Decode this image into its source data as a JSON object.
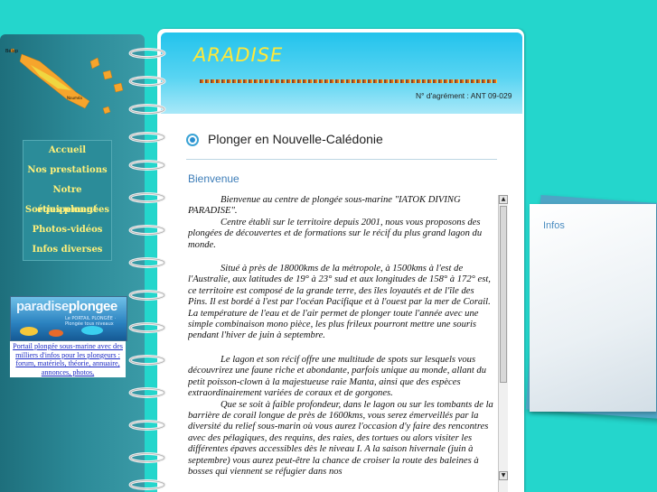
{
  "header": {
    "logo_text": "ARADISE",
    "agrement": "N° d'agrément : ANT 09-029"
  },
  "nav": {
    "items": [
      {
        "label": "Accueil"
      },
      {
        "label": "Nos prestations"
      },
      {
        "label": "Notre équipement"
      },
      {
        "label": "Sorties plongées"
      },
      {
        "label": "Photos-vidéos"
      },
      {
        "label": "Infos diverses"
      }
    ]
  },
  "banner": {
    "title_part1": "paradise",
    "title_part2": "plongee",
    "subtitle": "Le PORTAIL PLONGÉE · Plongée tous niveaux"
  },
  "portal_link": {
    "text": "Portail plongée sous-marine avec des milliers d'infos pour les plongeurs : forum, matériels, théorie, annuaire, annonces, photos,"
  },
  "main": {
    "title": "Plonger en Nouvelle-Calédonie",
    "section": "Bienvenue",
    "paragraphs": [
      "Bienvenue au centre de plongée sous-marine \"IATOK DIVING PARADISE\".",
      "Centre établi sur le territoire depuis 2001, nous vous proposons des plongées de découvertes et de formations sur le récif du plus grand lagon du monde.",
      "Situé à près de 18000kms de la métropole, à 1500kms à l'est de l'Australie, aux latitudes de 19° à 23° sud et aux longitudes de 158° à 172° est, ce territoire est composé de la grande terre, des îles loyautés et de l'île des Pins. Il est bordé à l'est par l'océan Pacifique et à l'ouest par la mer de Corail. La température de l'eau et de l'air permet de plonger toute l'année avec une simple combinaison mono pièce, les plus frileux pourront mettre une souris pendant l'hiver de juin à septembre.",
      "Le lagon et son récif offre une multitude de spots sur lesquels vous découvrirez une faune riche et abondante, parfois unique au monde, allant du petit poisson-clown à la majestueuse raie Manta, ainsi que des espèces extraordinairement variées de coraux et de gorgones.",
      "Que se soit à faible profondeur, dans le lagon ou sur les tombants de la barrière de corail longue de près de 1600kms, vous serez émerveillés par la diversité du relief sous-marin où vous aurez l'occasion d'y faire des rencontres avec des pélagiques, des requins, des raies, des tortues ou alors visiter les différentes épaves accessibles dès le niveau I. A la saison hivernale (juin à septembre) vous aurez peut-être la chance de croiser la route des baleines à bosses qui viennent se réfugier dans nos"
    ]
  },
  "side": {
    "infos_label": "Infos"
  },
  "colors": {
    "background": "#24d6cc",
    "nav_text": "#fff07a",
    "section_title": "#3d7db8",
    "logo": "#ffe83a"
  }
}
